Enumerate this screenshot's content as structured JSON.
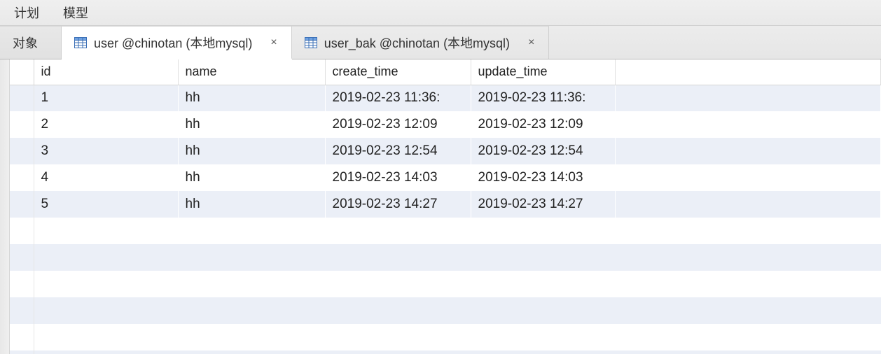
{
  "menubar": {
    "items": [
      "计划",
      "模型"
    ]
  },
  "tabstrip": {
    "objects_label": "对象",
    "tabs": [
      {
        "label": "user @chinotan (本地mysql)",
        "active": true
      },
      {
        "label": "user_bak @chinotan (本地mysql)",
        "active": false
      }
    ]
  },
  "grid": {
    "columns": [
      "id",
      "name",
      "create_time",
      "update_time"
    ],
    "rows": [
      {
        "id": "1",
        "name": "hh",
        "create_time": "2019-02-23 11:36:",
        "update_time": "2019-02-23 11:36:"
      },
      {
        "id": "2",
        "name": "hh",
        "create_time": "2019-02-23 12:09",
        "update_time": "2019-02-23 12:09"
      },
      {
        "id": "3",
        "name": "hh",
        "create_time": "2019-02-23 12:54",
        "update_time": "2019-02-23 12:54"
      },
      {
        "id": "4",
        "name": "hh",
        "create_time": "2019-02-23 14:03",
        "update_time": "2019-02-23 14:03"
      },
      {
        "id": "5",
        "name": "hh",
        "create_time": "2019-02-23 14:27",
        "update_time": "2019-02-23 14:27"
      }
    ]
  },
  "icons": {
    "table": "table-icon",
    "close": "×"
  }
}
